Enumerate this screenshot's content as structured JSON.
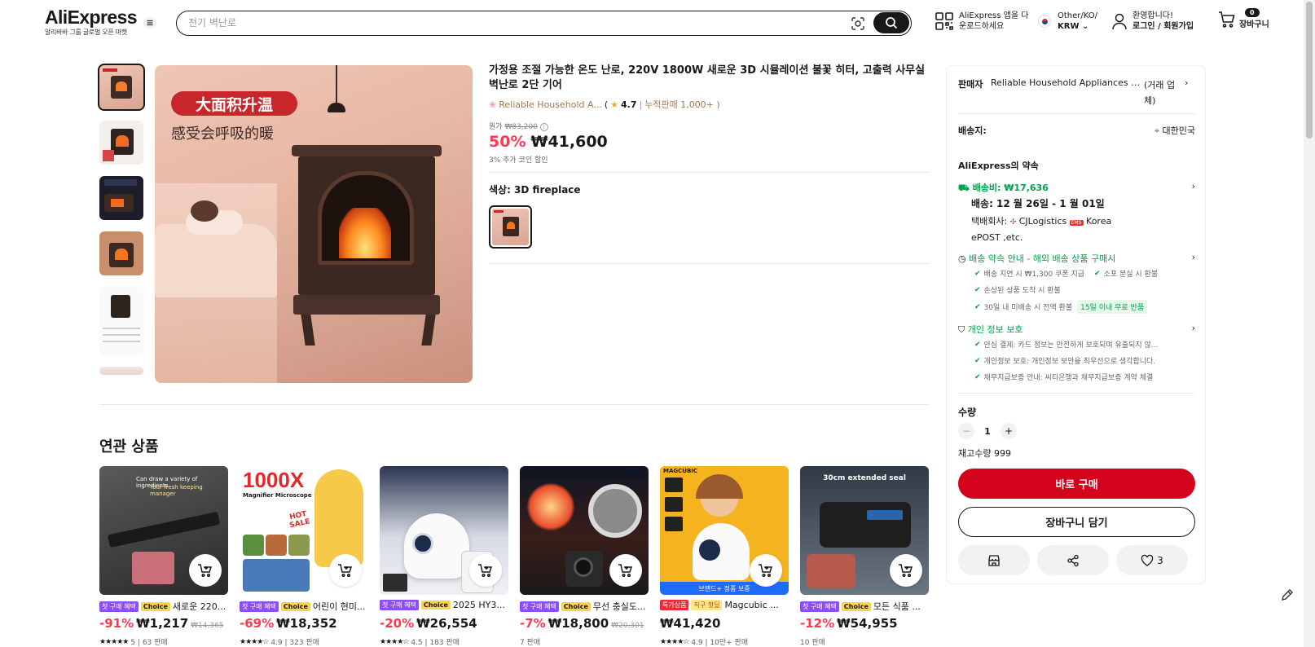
{
  "header": {
    "logo": "AliExpress",
    "logo_sub": "알리바바 그룹 글로벌 오픈 마켓",
    "search_placeholder": "전기 벽난로",
    "app_line1": "AliExpress 앱을 다",
    "app_line2": "운로드하세요",
    "region_line1": "Other/KO/",
    "region_line2": "KRW",
    "account_line1": "환영합니다!",
    "account_line2": "로그인 / 회원가입",
    "cart_count": "0",
    "cart_label": "장바구니"
  },
  "product": {
    "title": "가정용 조절 가능한 온도 난로, 220V 1800W 새로운 3D 시뮬레이션 불꽃 히터, 고출력 사무실 벽난로 2단 기어",
    "store_name": "Reliable Household A...",
    "rating": "4.7",
    "sold": "누적판매 1,000+ )",
    "orig_label": "원가",
    "orig_price": "₩83,200",
    "discount": "50%",
    "price": "₩41,600",
    "coin_note": "3% 추가 코인 할인",
    "color_label": "색상: 3D fireplace",
    "image_text_1": "大面积升温",
    "image_text_2": "感受会呼吸的暖"
  },
  "panel": {
    "seller_label": "판매자",
    "seller_name": "Reliable Household Appliances St...",
    "seller_type_1": "(거래 업",
    "seller_type_2": "체)",
    "ship_to_label": "배송지:",
    "ship_to_value": "대한민국",
    "promise_title": "AliExpress의 약속",
    "shipping_fee": "배송비: ₩17,636",
    "delivery_date": "배송: 12 월 26일 - 1 월 01일",
    "carrier_label": "택배회사:",
    "carrier_1": "CJLogistics",
    "carrier_2": "Korea",
    "carrier_3": "ePOST ,etc.",
    "guarantee_title": "배송 약속 안내 - 해외 배송 상품 구매시",
    "g1": "배송 지연 시 ₩1,300 쿠폰 지급",
    "g2": "소포 분실 시 환불",
    "g3": "손상된 상품 도착 시 환불",
    "g4": "30일 내 미배송 시 전액 환불",
    "g4_badge": "15일 이내 무료 반품",
    "privacy_title": "개인 정보 보호",
    "p1": "안심 결제: 카드 정보는 안전하게 보호되며 유출되지 않...",
    "p2": "개인정보 보호: 개인정보 보안을 최우선으로 생각합니다.",
    "p3": "채무지급보증 안내: 씨티은행과 채무지급보증 계약 체결",
    "qty_label": "수량",
    "qty_value": "1",
    "stock": "재고수량 999",
    "buy_now": "바로 구매",
    "add_to_cart": "장바구니 담기",
    "wish_count": "3"
  },
  "related": {
    "title": "연관 상품",
    "items": [
      {
        "badge1": "첫 구매 혜택",
        "badge2": "Choice",
        "name": "새로운 220...",
        "discount": "-91%",
        "price": "₩1,217",
        "orig": "₩14,365",
        "stars": "★★★★★",
        "meta": "5 | 63 판매"
      },
      {
        "badge1": "첫 구매 혜택",
        "badge2": "Choice",
        "name": "어린이 현미...",
        "discount": "-69%",
        "price": "₩18,352",
        "orig": "",
        "stars": "★★★★☆",
        "meta": "4.9 | 323 판매"
      },
      {
        "badge1": "첫 구매 혜택",
        "badge2": "Choice",
        "name": "2025 HY3...",
        "discount": "-20%",
        "price": "₩26,554",
        "orig": "",
        "stars": "★★★★☆",
        "meta": "4.5 | 183 판매"
      },
      {
        "badge1": "첫 구매 혜택",
        "badge2": "Choice",
        "name": "무선 충실도...",
        "discount": "-7%",
        "price": "₩18,800",
        "orig": "₩20,301",
        "stars": "",
        "meta": "7 판매"
      },
      {
        "badge1": "특가상품",
        "badge2": "직구 핫딜",
        "name": "Magcubic ...",
        "discount": "",
        "price": "₩41,420",
        "orig": "",
        "stars": "★★★★☆",
        "meta": "4.9 | 10만+ 판매"
      },
      {
        "badge1": "첫 구매 혜택",
        "badge2": "Choice",
        "name": "모든 식품 ...",
        "discount": "-12%",
        "price": "₩54,955",
        "orig": "",
        "stars": "",
        "meta": "10 판매"
      }
    ],
    "img_texts": {
      "c1": "Can draw a variety of ingredients",
      "c1b": "Your fresh keeping manager",
      "c2": "1000X",
      "c2b": "Magnifier Microscope",
      "c2c": "HOT SALE",
      "c5": "MAGCUBIC",
      "c5b": "브랜드+ 정품 보증",
      "c6": "30cm extended seal"
    }
  },
  "colors": {
    "accent_red": "#fd384f",
    "buy_red": "#d3031c",
    "green": "#00a24e",
    "choice_yellow": "#fcd34d",
    "badge_purple": "#8e4ef5"
  }
}
